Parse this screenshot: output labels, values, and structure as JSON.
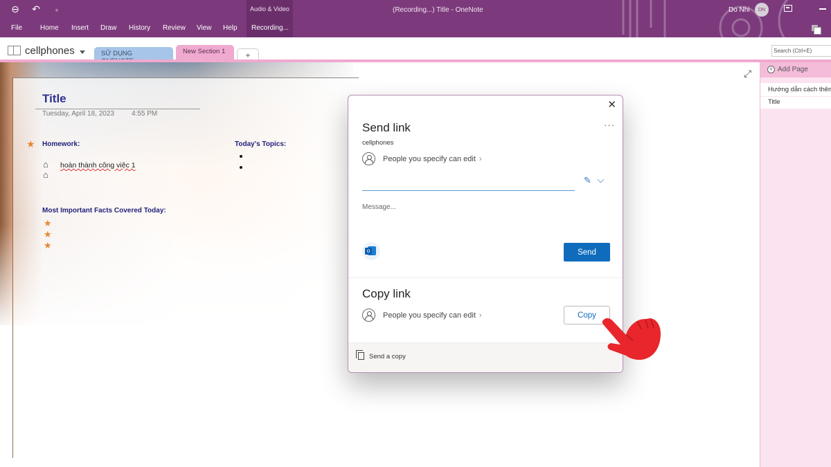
{
  "titlebar": {
    "app_title": "(Recording...) Title  -  OneNote",
    "contextual_group": "Audio & Video",
    "user_name": "Do Nhi",
    "user_initials": "DN",
    "qat": {
      "back_icon": "back-icon",
      "undo_icon": "undo-icon",
      "customize_icon": "customize-qat-icon"
    }
  },
  "ribbon": {
    "tabs": [
      {
        "label": "File"
      },
      {
        "label": "Home"
      },
      {
        "label": "Insert"
      },
      {
        "label": "Draw"
      },
      {
        "label": "History"
      },
      {
        "label": "Review"
      },
      {
        "label": "View"
      },
      {
        "label": "Help"
      },
      {
        "label": "Recording..."
      }
    ]
  },
  "notebook": {
    "name": "cellphones",
    "sections": [
      {
        "label": "SỬ DỤNG ONENOTE",
        "color": "#a7c5e8"
      },
      {
        "label": "New Section 1",
        "color": "#f0a9cf",
        "active": true
      }
    ],
    "add_section_label": "+",
    "search_placeholder": "Search (Ctrl+E)"
  },
  "page": {
    "title": "Title",
    "date": "Tuesday, April 18, 2023",
    "time": "4:55 PM",
    "homework_label": "Homework:",
    "todo_items": [
      "hoàn thành công việc 1",
      ""
    ],
    "topics_label": "Today's Topics:",
    "topics": [
      "",
      ""
    ],
    "facts_label": "Most Important Facts Covered Today:",
    "facts": [
      "",
      "",
      ""
    ]
  },
  "page_list": {
    "add_page_label": "Add Page",
    "pages": [
      {
        "label": "Hướng dẫn cách thêm"
      },
      {
        "label": "Title"
      }
    ]
  },
  "share_dialog": {
    "send_title": "Send link",
    "notebook_name": "cellphones",
    "send_permission": "People you specify can edit",
    "message_placeholder": "Message...",
    "send_button": "Send",
    "copy_title": "Copy link",
    "copy_permission": "People you specify can edit",
    "copy_button": "Copy",
    "footer_label": "Send a copy",
    "accent_color": "#0f6cbd"
  }
}
